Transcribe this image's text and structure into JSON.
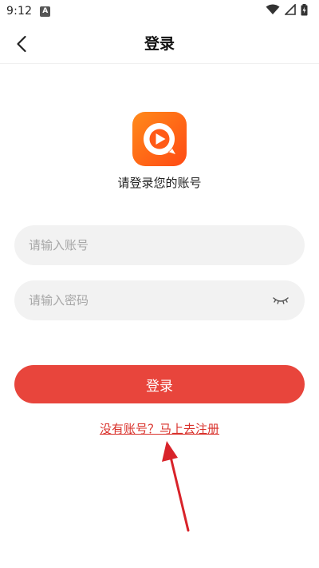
{
  "status_bar": {
    "time": "9:12",
    "notification_label": "A",
    "icons": [
      "wifi-icon",
      "signal-icon",
      "battery-charging-icon"
    ]
  },
  "header": {
    "title": "登录",
    "back_icon": "chevron-left-icon"
  },
  "logo": {
    "icon": "play-bubble-logo-icon",
    "caption": "请登录您的账号",
    "colors": {
      "gradient_start": "#ff8a1a",
      "gradient_end": "#ff4a14"
    }
  },
  "form": {
    "account": {
      "placeholder": "请输入账号",
      "value": ""
    },
    "password": {
      "placeholder": "请输入密码",
      "value": "",
      "toggle_icon": "eye-closed-icon"
    },
    "login_label": "登录",
    "register_label": "没有账号？马上去注册"
  },
  "colors": {
    "accent": "#e8453c",
    "link": "#d9302a",
    "field_bg": "#f2f2f2",
    "annotation_arrow": "#d8232a"
  }
}
